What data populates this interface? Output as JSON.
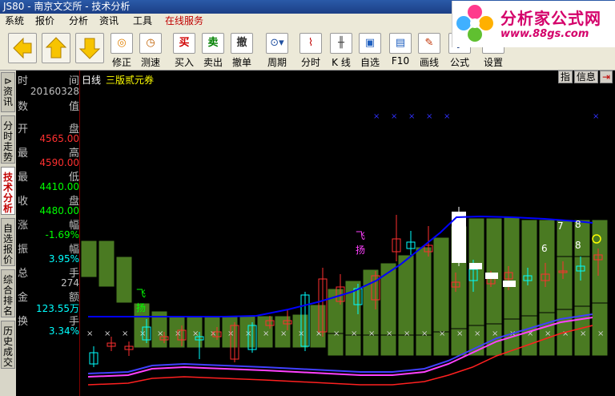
{
  "window": {
    "title": "JS80 - 南京文交所 - 技术分析"
  },
  "menu": {
    "items": [
      "系统",
      "报价",
      "分析",
      "资讯",
      "工具"
    ],
    "online": "在线服务"
  },
  "logo": {
    "brand": "分析家公式网",
    "url": "www.88gs.com"
  },
  "toolbar": {
    "buttons": [
      {
        "label": "修正",
        "icon": "refresh-icon"
      },
      {
        "label": "测速",
        "icon": "clock-icon"
      },
      {
        "label": "买入",
        "icon": "buy-icon",
        "glyph": "买"
      },
      {
        "label": "卖出",
        "icon": "sell-icon",
        "glyph": "卖"
      },
      {
        "label": "撤单",
        "icon": "cancel-icon",
        "glyph": "撤"
      },
      {
        "label": "周期",
        "icon": "period-icon"
      },
      {
        "label": "分时",
        "icon": "timeline-icon"
      },
      {
        "label": "K 线",
        "icon": "candlestick-icon"
      },
      {
        "label": "自选",
        "icon": "favorites-icon"
      },
      {
        "label": "F10",
        "icon": "f10-icon"
      },
      {
        "label": "画线",
        "icon": "draw-icon"
      },
      {
        "label": "公式",
        "icon": "formula-icon"
      },
      {
        "label": "设置",
        "icon": "settings-icon"
      }
    ]
  },
  "sidetabs": [
    "资讯",
    "分时走势",
    "技术分析",
    "自选报价",
    "综合排名",
    "历史成交"
  ],
  "sidetab_active": 2,
  "info": {
    "time_l": "时",
    "time_r": "间",
    "time_v": "20160328",
    "val_l": "数",
    "val_r": "值",
    "open_l": "开",
    "open_r": "盘",
    "open_v": "4565.00",
    "high_l": "最",
    "high_r": "高",
    "high_v": "4590.00",
    "low_l": "最",
    "low_r": "低",
    "low_v": "4410.00",
    "close_l": "收",
    "close_r": "盘",
    "close_v": "4480.00",
    "chg_l": "涨",
    "chg_r": "幅",
    "chg_v": "-1.69%",
    "amp_l": "振",
    "amp_r": "幅",
    "amp_v": "3.95%",
    "vol_l": "总",
    "vol_r": "手",
    "vol_v": "274",
    "amt_l": "金",
    "amt_r": "额",
    "amt_v": "123.55万",
    "turn_l": "换",
    "turn_r": "手",
    "turn_v": "3.34%"
  },
  "chart": {
    "period": "日线",
    "security": "三版贰元券",
    "btn_zhi": "指",
    "btn_info": "信息",
    "annotations": [
      "飞扬",
      "飞扬",
      "7",
      "8",
      "6",
      "8"
    ]
  },
  "colors": {
    "up": "#ff3030",
    "down": "#00ffff",
    "box": "#4a7a22",
    "ma": "#0000ff",
    "band_upper": "#ff40ff",
    "band_lower": "#ff2020"
  }
}
